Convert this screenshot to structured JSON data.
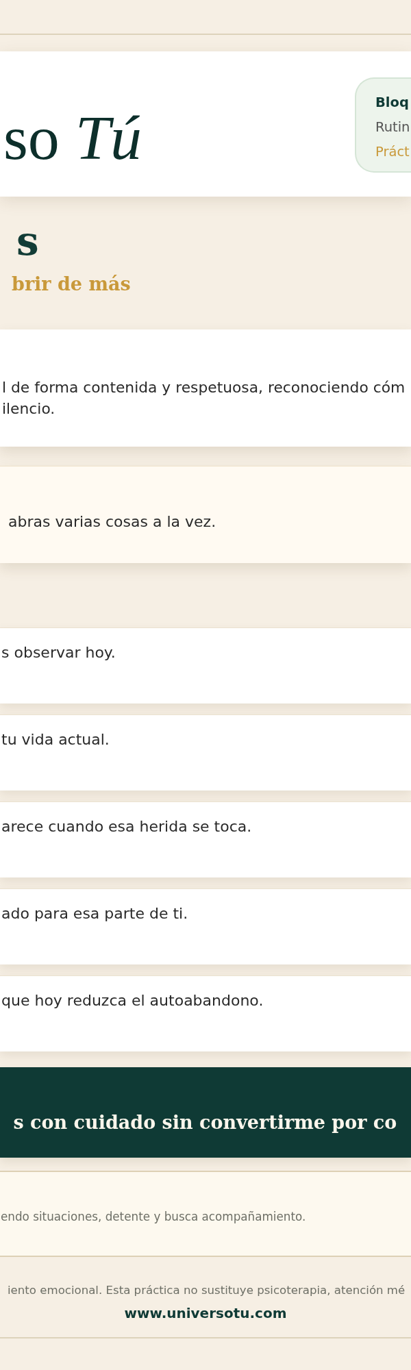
{
  "header": {
    "logo": "so *Tú*",
    "badge": [
      {
        "kind": "title",
        "text": "Bloq"
      },
      {
        "kind": "subtitle",
        "text": "Rutin"
      },
      {
        "kind": "accent",
        "text": "Práct"
      }
    ]
  },
  "hero": {
    "title": "s",
    "subtitle": "brir de más"
  },
  "intro_card": {
    "text": "l de forma contenida y respetuosa, reconociendo cóm\nilencio."
  },
  "tip_card": {
    "text": "abras varias cosas a la vez."
  },
  "steps": [
    "s observar hoy.",
    "tu vida actual.",
    "arece cuando esa herida se toca.",
    "ado para esa parte de ti.",
    "que hoy reduzca el autoabandono."
  ],
  "banner": {
    "text": "s con cuidado sin convertirme por co"
  },
  "note": {
    "text": "endo situaciones, detente y busca acompañamiento."
  },
  "footer": {
    "disclaimer": "iento emocional. Esta práctica no sustituye psicoterapia, atención mé",
    "link": "www.universotu.com"
  }
}
